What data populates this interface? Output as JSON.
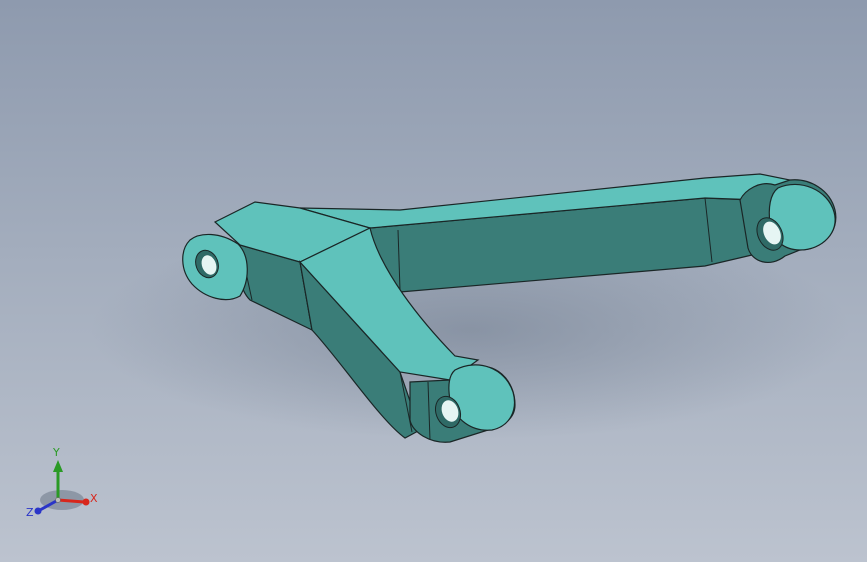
{
  "viewport": {
    "part_color": "#5fc2bb",
    "part_shade": "#3a7d78",
    "part_edge": "#1a2626"
  },
  "triad": {
    "x_label": "X",
    "y_label": "Y",
    "z_label": "Z",
    "x_color": "#d8261c",
    "y_color": "#2a9a25",
    "z_color": "#2a35c8"
  }
}
